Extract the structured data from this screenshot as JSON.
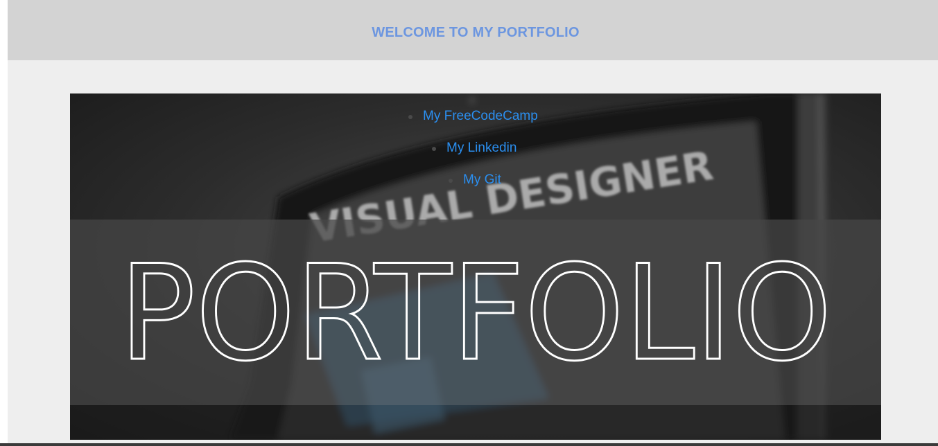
{
  "header": {
    "title": "WELCOME TO MY PORTFOLIO"
  },
  "nav": {
    "links": [
      {
        "label": "My FreeCodeCamp"
      },
      {
        "label": "My Linkedin"
      },
      {
        "label": "My Git"
      }
    ]
  },
  "hero": {
    "background_text": "VISUAL DESIGNER",
    "headline": "PORTFOLIO"
  },
  "colors": {
    "header_background": "#d3d3d3",
    "header_title": "#6c96e0",
    "page_background": "#eeeeee",
    "link": "#2b8ff0"
  }
}
